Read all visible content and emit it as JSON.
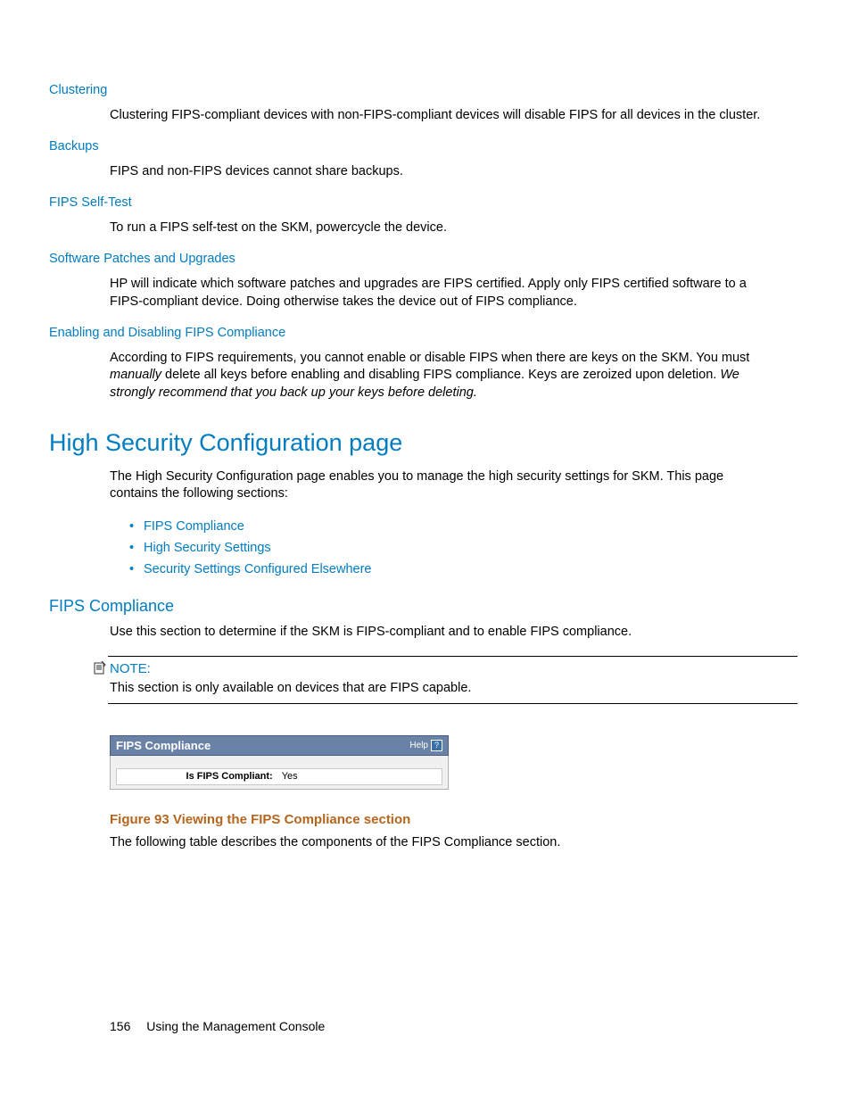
{
  "sections": {
    "clustering": {
      "heading": "Clustering",
      "body": "Clustering FIPS-compliant devices with non-FIPS-compliant devices will disable FIPS for all devices in the cluster."
    },
    "backups": {
      "heading": "Backups",
      "body": "FIPS and non-FIPS devices cannot share backups."
    },
    "selftest": {
      "heading": "FIPS Self-Test",
      "body": "To run a FIPS self-test on the SKM, powercycle the device."
    },
    "patches": {
      "heading": "Software Patches and Upgrades",
      "body": "HP will indicate which software patches and upgrades are FIPS certified. Apply only FIPS certified software to a FIPS-compliant device. Doing otherwise takes the device out of FIPS compliance."
    },
    "enable": {
      "heading": "Enabling and Disabling FIPS Compliance",
      "body_pre": "According to FIPS requirements, you cannot enable or disable FIPS when there are keys on the SKM. You must ",
      "body_ital1": "manually",
      "body_mid": " delete all keys before enabling and disabling FIPS compliance. Keys are zeroized upon deletion. ",
      "body_ital2": "We strongly recommend that you back up your keys before deleting."
    }
  },
  "hsc": {
    "heading": "High Security Configuration page",
    "intro": "The High Security Configuration page enables you to manage the high security settings for SKM. This page contains the following sections:",
    "bullets": [
      "FIPS Compliance",
      "High Security Settings",
      "Security Settings Configured Elsewhere"
    ]
  },
  "fips": {
    "heading": "FIPS Compliance",
    "body": "Use this section to determine if the SKM is FIPS-compliant and to enable FIPS compliance.",
    "note_label": "NOTE:",
    "note_body": "This section is only available on devices that are FIPS capable."
  },
  "figure": {
    "panel_title": "FIPS Compliance",
    "help": "Help",
    "row_label": "Is FIPS Compliant:",
    "row_value": "Yes",
    "caption": "Figure 93 Viewing the FIPS Compliance section",
    "followup": "The following table describes the components of the FIPS Compliance section."
  },
  "footer": {
    "page": "156",
    "title": "Using the Management Console"
  }
}
